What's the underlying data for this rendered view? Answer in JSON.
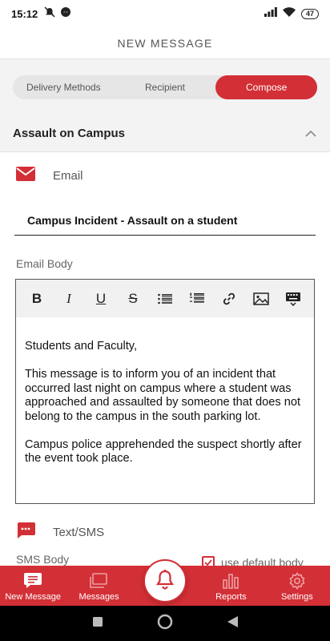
{
  "status_bar": {
    "time": "15:12",
    "battery": "47"
  },
  "header": {
    "title": "NEW MESSAGE"
  },
  "tabs": [
    {
      "label": "Delivery Methods",
      "active": false
    },
    {
      "label": "Recipient",
      "active": false
    },
    {
      "label": "Compose",
      "active": true
    }
  ],
  "section": {
    "title": "Assault on Campus"
  },
  "email": {
    "label": "Email",
    "subject": "Campus Incident - Assault on a student",
    "body_label": "Email Body",
    "toolbar": [
      "bold-icon",
      "italic-icon",
      "underline-icon",
      "strikethrough-icon",
      "bullet-list-icon",
      "numbered-list-icon",
      "link-icon",
      "image-icon",
      "keyboard-icon"
    ],
    "body": {
      "p1": "Students and Faculty,",
      "p2": "This message is to inform you of an incident that occurred last night on campus where a student was approached and assaulted by someone that does not belong to the campus in the south parking lot.",
      "p3": "Campus police apprehended the suspect shortly after the event took place."
    }
  },
  "sms": {
    "label": "Text/SMS",
    "body_label": "SMS Body",
    "use_default_label": "use default body",
    "use_default_checked": true
  },
  "bottom_nav": [
    {
      "label": "New Message",
      "icon": "new-message-icon",
      "active": true
    },
    {
      "label": "Messages",
      "icon": "messages-icon",
      "active": false
    },
    {
      "label": "Reports",
      "icon": "reports-icon",
      "active": false
    },
    {
      "label": "Settings",
      "icon": "settings-icon",
      "active": false
    }
  ],
  "colors": {
    "accent": "#d32f36",
    "background": "#f3f3f3"
  }
}
